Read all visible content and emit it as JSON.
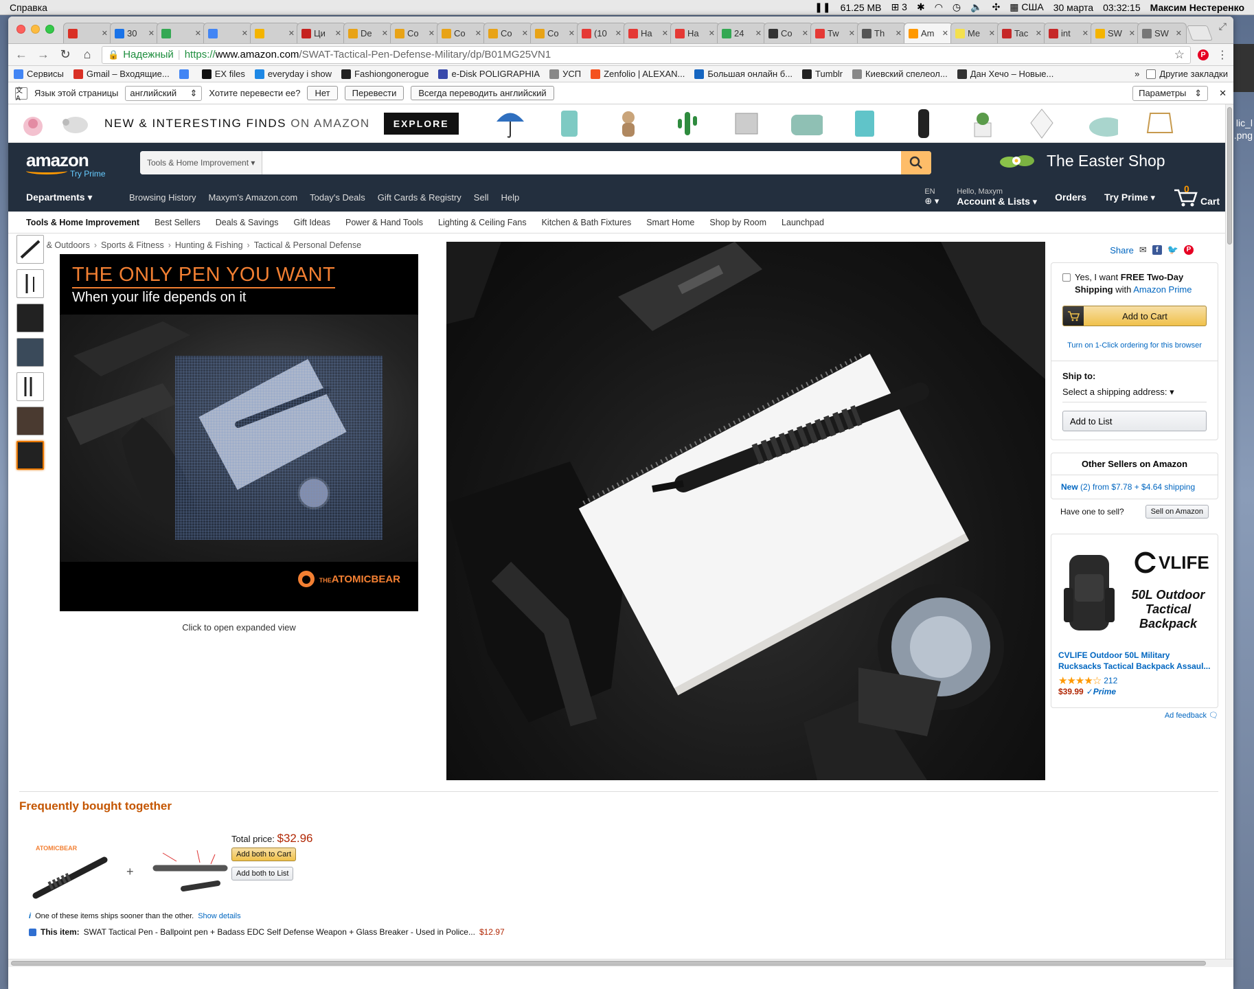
{
  "os": {
    "menu_app": "Справка",
    "memory": "61.25 MB",
    "count": "3",
    "locale": "США",
    "date": "30 марта",
    "time": "03:32:15",
    "user": "Максим Нестеренко",
    "desktop_file_label": "lic_l .png"
  },
  "browser": {
    "tabs": [
      {
        "label": "",
        "color": "#d93025"
      },
      {
        "label": "30",
        "color": "#1a73e8"
      },
      {
        "label": "",
        "color": "#34a853"
      },
      {
        "label": "",
        "color": "#4285f4"
      },
      {
        "label": "",
        "color": "#f4b400"
      },
      {
        "label": "Ци",
        "color": "#c5221f"
      },
      {
        "label": "De",
        "color": "#e8a317"
      },
      {
        "label": "Co",
        "color": "#e8a317"
      },
      {
        "label": "Co",
        "color": "#e8a317"
      },
      {
        "label": "Co",
        "color": "#e8a317"
      },
      {
        "label": "Co",
        "color": "#e8a317"
      },
      {
        "label": "(10",
        "color": "#e53935"
      },
      {
        "label": "Ha",
        "color": "#e53935"
      },
      {
        "label": "Ha",
        "color": "#e53935"
      },
      {
        "label": "24",
        "color": "#34a853"
      },
      {
        "label": "Co",
        "color": "#333333"
      },
      {
        "label": "Tw",
        "color": "#e53935"
      },
      {
        "label": "Th",
        "color": "#555555"
      },
      {
        "label": "Am",
        "color": "#ff9900",
        "active": true
      },
      {
        "label": "Me",
        "color": "#f4e04d"
      },
      {
        "label": "Tac",
        "color": "#c62828"
      },
      {
        "label": "int",
        "color": "#c62828"
      },
      {
        "label": "SW",
        "color": "#f4b400"
      },
      {
        "label": "SW",
        "color": "#777777"
      }
    ],
    "secure_label": "Надежный",
    "url_scheme": "https://",
    "url_host": "www.amazon.com",
    "url_path": "/SWAT-Tactical-Pen-Defense-Military/dp/B01MG25VN1",
    "bookmarks": [
      {
        "label": "Сервисы",
        "color": "#4285f4"
      },
      {
        "label": "Gmail – Входящие...",
        "color": "#d93025"
      },
      {
        "label": "",
        "color": "#4285f4"
      },
      {
        "label": "EX files",
        "color": "#111111"
      },
      {
        "label": "everyday i show",
        "color": "#1e88e5"
      },
      {
        "label": "Fashiongonerogue",
        "color": "#222222"
      },
      {
        "label": "e-Disk POLIGRAPHIA",
        "color": "#3949ab"
      },
      {
        "label": "УСП",
        "color": "#888888"
      },
      {
        "label": "Zenfolio | ALEXAN...",
        "color": "#f4511e"
      },
      {
        "label": "Большая онлайн б...",
        "color": "#1565c0"
      },
      {
        "label": "Tumblr",
        "color": "#222222"
      },
      {
        "label": "Киевский спелеол...",
        "color": "#888888"
      },
      {
        "label": "Дан Хечо – Новые...",
        "color": "#333333"
      }
    ],
    "bookmarks_other": "Другие закладки",
    "translate": {
      "page_lang_label": "Язык этой страницы",
      "lang": "английский",
      "question": "Хотите перевести ее?",
      "no": "Нет",
      "translate": "Перевести",
      "always": "Всегда переводить английский",
      "params": "Параметры"
    }
  },
  "promo": {
    "title_main": "NEW & INTERESTING FINDS",
    "title_on": "ON AMAZON",
    "explore": "EXPLORE"
  },
  "header": {
    "logo": "amazon",
    "try_prime": "Try Prime",
    "search_category": "Tools & Home Improvement",
    "search_value": "",
    "easter_shop": "The Easter Shop",
    "departments": "Departments",
    "nav_links": [
      "Browsing History",
      "Maxym's Amazon.com",
      "Today's Deals",
      "Gift Cards & Registry",
      "Sell",
      "Help"
    ],
    "lang": "EN",
    "hello": "Hello, Maxym",
    "account": "Account & Lists",
    "orders": "Orders",
    "try_prime_nav": "Try Prime",
    "cart_count": "0",
    "cart": "Cart"
  },
  "subnav": {
    "main": "Tools & Home Improvement",
    "items": [
      "Best Sellers",
      "Deals & Savings",
      "Gift Ideas",
      "Power & Hand Tools",
      "Lighting & Ceiling Fans",
      "Kitchen & Bath Fixtures",
      "Smart Home",
      "Shop by Room",
      "Launchpad"
    ]
  },
  "breadcrumb": [
    "Sports & Outdoors",
    "Sports & Fitness",
    "Hunting & Fishing",
    "Tactical & Personal Defense"
  ],
  "product_ad": {
    "headline": "THE ONLY PEN YOU WANT",
    "subline": "When your life depends on it",
    "brand_small": "THE",
    "brand": "ATOMICBEAR",
    "caption": "Click to open expanded view"
  },
  "buybox": {
    "share": "Share",
    "free_shipping_pre": "Yes, I want ",
    "free_shipping_bold": "FREE Two-Day Shipping",
    "free_shipping_post": " with ",
    "free_shipping_link": "Amazon Prime",
    "add_to_cart": "Add to Cart",
    "one_click": "Turn on 1-Click ordering for this browser",
    "ship_to": "Ship to:",
    "ship_select": "Select a shipping address:",
    "add_to_list": "Add to List",
    "other_sellers": "Other Sellers on Amazon",
    "new_label": "New",
    "new_detail": " (2) from $7.78 + $4.64 shipping",
    "have_one": "Have one to sell?",
    "sell_btn": "Sell on Amazon"
  },
  "sponsored": {
    "brand": "VLIFE",
    "tagline": "50L Outdoor Tactical Backpack",
    "title": "CVLIFE Outdoor 50L Military Rucksacks Tactical Backpack Assaul...",
    "stars": "★★★★☆",
    "reviews": "212",
    "price": "$39.99",
    "prime": "✓Prime",
    "feedback": "Ad feedback"
  },
  "fbt": {
    "title": "Frequently bought together",
    "total_label": "Total price: ",
    "total": "$32.96",
    "add_both_cart": "Add both to Cart",
    "add_both_list": "Add both to List",
    "note": "One of these items ships sooner than the other.",
    "show_details": "Show details",
    "line_prefix": "This item:",
    "line_text": "SWAT Tactical Pen - Ballpoint pen + Badass EDC Self Defense Weapon + Glass Breaker - Used in Police...",
    "line_price": "$12.97"
  }
}
